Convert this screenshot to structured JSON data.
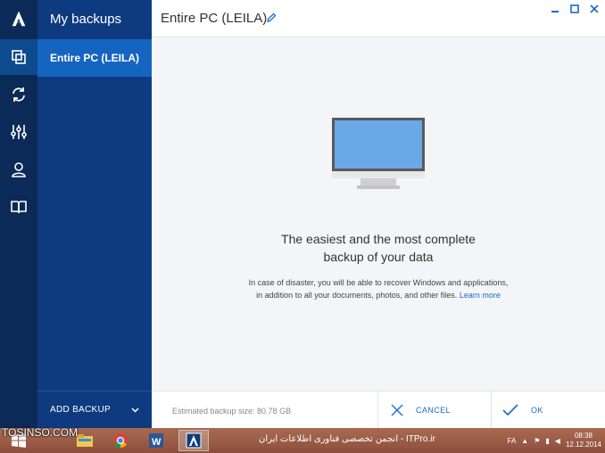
{
  "window": {
    "title": "Entire PC (LEILA)"
  },
  "sidebar": {
    "heading": "My backups",
    "items": [
      {
        "label": "Entire PC (LEILA)"
      }
    ],
    "add_backup_label": "ADD BACKUP"
  },
  "nav_rail": {
    "icons": [
      "acronis-logo-icon",
      "backup-icon",
      "sync-icon",
      "tools-icon",
      "account-icon",
      "help-book-icon"
    ],
    "active": "backup-icon"
  },
  "main": {
    "headline_line1": "The easiest and the most complete",
    "headline_line2": "backup of your data",
    "desc_line1": "In case of disaster, you will be able to recover Windows and applications,",
    "desc_line2": "in addition to all your documents, photos, and other files.",
    "learn_more": "Learn more"
  },
  "footer": {
    "estimate": "Estimated backup size:  80.78 GB",
    "cancel_label": "CANCEL",
    "ok_label": "OK"
  },
  "watermark": "TOSINSO.COM",
  "taskbar": {
    "center_text": "انجمن تخصصی فناوری اطلاعات ایران - ITPro.ir",
    "time": "08:38",
    "date": "12.12.2014",
    "lang": "FA"
  },
  "colors": {
    "rail": "#0b2a57",
    "pane": "#0e3b80",
    "selected": "#1565c0",
    "accent": "#1a6ac9",
    "monitor_screen": "#6aa8e8"
  }
}
